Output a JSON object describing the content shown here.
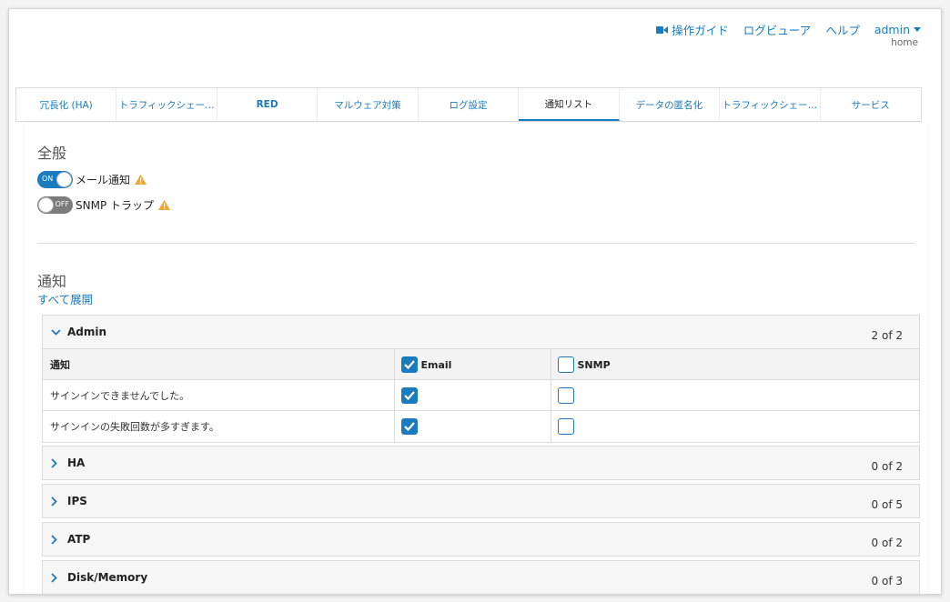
{
  "topnav": {
    "guide": "操作ガイド",
    "log_viewer": "ログビューア",
    "help": "ヘルプ",
    "user": "admin",
    "location": "home"
  },
  "tabs": [
    {
      "label": "冗長化 (HA)"
    },
    {
      "label": "トラフィックシェー…"
    },
    {
      "label": "RED"
    },
    {
      "label": "マルウェア対策"
    },
    {
      "label": "ログ設定"
    },
    {
      "label": "通知リスト"
    },
    {
      "label": "データの匿名化"
    },
    {
      "label": "トラフィックシェー…"
    },
    {
      "label": "サービス"
    }
  ],
  "general": {
    "title": "全般",
    "mail": {
      "label": "メール通知",
      "state": "ON"
    },
    "snmp": {
      "label": "SNMP トラップ",
      "state": "OFF"
    }
  },
  "notify": {
    "title": "通知",
    "expand_all": "すべて展開",
    "admin": {
      "name": "Admin",
      "count": "2 of 2",
      "col_notify": "通知",
      "col_email": "Email",
      "col_snmp": "SNMP",
      "rows": [
        {
          "label": "サインインできませんでした。",
          "email": true,
          "snmp": false
        },
        {
          "label": "サインインの失敗回数が多すぎます。",
          "email": true,
          "snmp": false
        }
      ]
    },
    "groups": [
      {
        "name": "HA",
        "count": "0 of 2"
      },
      {
        "name": "IPS",
        "count": "0 of 5"
      },
      {
        "name": "ATP",
        "count": "0 of 2"
      },
      {
        "name": "Disk/Memory",
        "count": "0 of 3"
      }
    ]
  },
  "colors": {
    "accent": "#1a7bbf",
    "warning": "#f0a830"
  }
}
